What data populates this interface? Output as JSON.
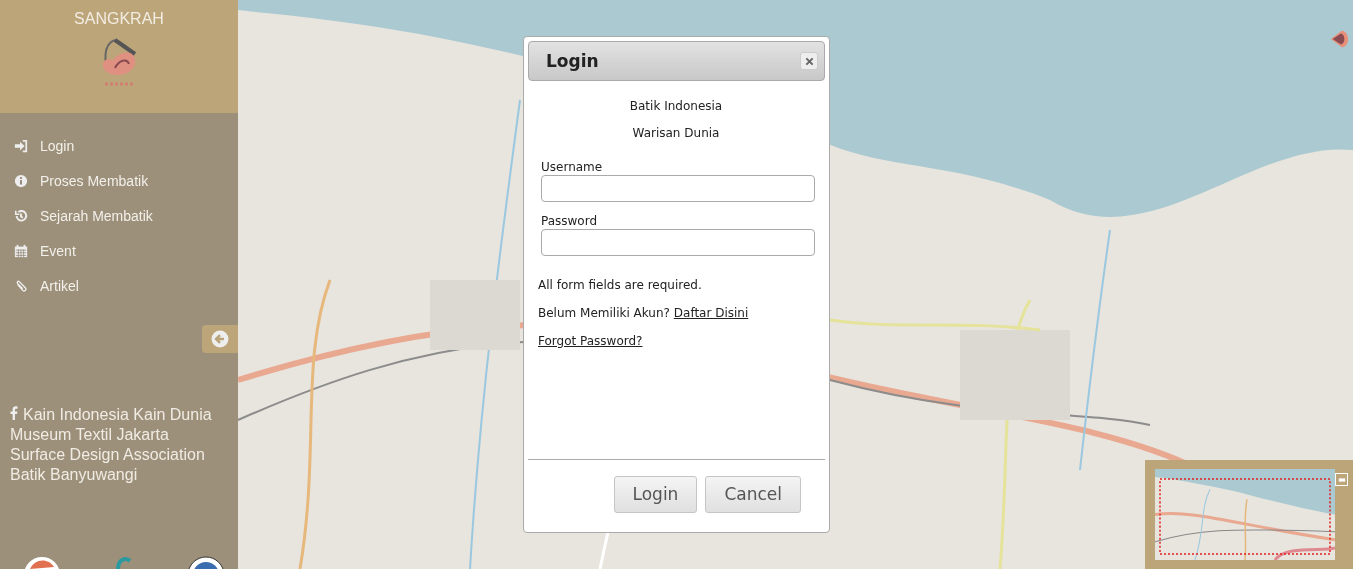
{
  "sidebar": {
    "brand": "SANGKRAH",
    "menu": [
      {
        "label": "Login",
        "kind": "login"
      },
      {
        "label": "Proses Membatik",
        "kind": "info"
      },
      {
        "label": "Sejarah Membatik",
        "kind": "history"
      },
      {
        "label": "Event",
        "kind": "calendar"
      },
      {
        "label": "Artikel",
        "kind": "paperclip"
      }
    ],
    "links": [
      {
        "label": "Kain Indonesia Kain Dunia",
        "kind": "facebook"
      },
      {
        "label": "Museum Textil Jakarta",
        "kind": "plain"
      },
      {
        "label": "Surface Design Association",
        "kind": "plain"
      },
      {
        "label": "Batik Banyuwangi",
        "kind": "plain"
      }
    ]
  },
  "dialog": {
    "title": "Login",
    "lines": [
      "Batik Indonesia",
      "Warisan Dunia"
    ],
    "fields": [
      {
        "label": "Username"
      },
      {
        "label": "Password"
      }
    ],
    "note": "All form fields are required.",
    "signup": {
      "prompt": "Belum Memiliki Akun?",
      "link": "Daftar Disini"
    },
    "forgot": "Forgot Password?",
    "buttons": [
      "Login",
      "Cancel"
    ]
  }
}
